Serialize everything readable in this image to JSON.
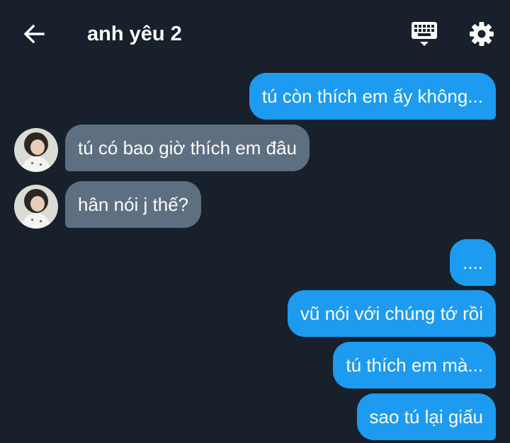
{
  "header": {
    "title": "anh yêu 2",
    "back_icon": "arrow-left-icon",
    "keyboard_icon": "keyboard-icon",
    "settings_icon": "gear-icon"
  },
  "colors": {
    "background": "#17202b",
    "sent_bubble": "#1d9bf0",
    "received_bubble": "#5e6f82",
    "text": "#ffffff"
  },
  "messages": [
    {
      "side": "sent",
      "text": "tú còn thích em ấy không..."
    },
    {
      "side": "received",
      "text": "tú có bao giờ thích em đâu"
    },
    {
      "side": "received",
      "text": "hân nói j thế?"
    },
    {
      "side": "sent",
      "text": "...."
    },
    {
      "side": "sent",
      "text": "vũ nói với chúng tớ rồi"
    },
    {
      "side": "sent",
      "text": "tú thích em mà..."
    },
    {
      "side": "sent",
      "text": "sao tú lại giấu"
    }
  ]
}
